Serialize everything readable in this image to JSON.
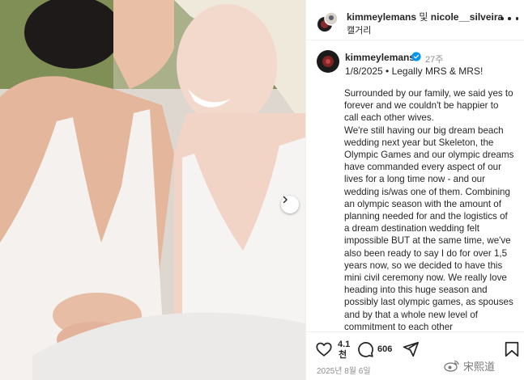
{
  "post": {
    "header": {
      "collab_line": "kimmeylemans 및 nicole__silveira",
      "collab_user_1": "kimmeylemans",
      "collab_conj": " 및 ",
      "collab_user_2": "nicole__silveira",
      "location": "캘거리"
    },
    "caption": {
      "username": "kimmeylemans",
      "time_ago": "27주",
      "first_line": "1/8/2025 • Legally MRS & MRS!",
      "paragraph_1": "Surrounded by our family, we said yes to forever and we couldn't be happier to call each other wives.",
      "paragraph_2": "We're still having our big dream beach wedding next year but Skeleton, the Olympic Games and our olympic dreams have commanded every aspect of our lives for a long time now - and our wedding is/was one of them. Combining an olympic season with the amount of planning needed for and the logistics of a dream destination wedding felt impossible BUT at the same time, we've also been ready to say I do for over 1,5 years now, so we decided to have this mini civil ceremony now. We really love heading into this huge season and possibly last olympic games, as spouses and by that a whole new level of commitment to each other"
    },
    "actions": {
      "likes": "4.1천",
      "likes_top": "4.1",
      "likes_bottom": "천",
      "comments": "606",
      "date": "2025년 8월 6일"
    }
  },
  "icons": {
    "more": "more-horizontal-icon",
    "verified": "verified-badge-icon",
    "like": "heart-icon",
    "comment": "comment-bubble-icon",
    "share": "share-send-icon",
    "save": "bookmark-icon",
    "carousel": "chevron-right-icon",
    "watermark": "weibo-icon"
  },
  "watermark": {
    "text": "宋熙道"
  },
  "colors": {
    "text": "#262626",
    "secondary": "#8e8e8e",
    "verified": "#0095f6",
    "divider": "#efefef"
  }
}
